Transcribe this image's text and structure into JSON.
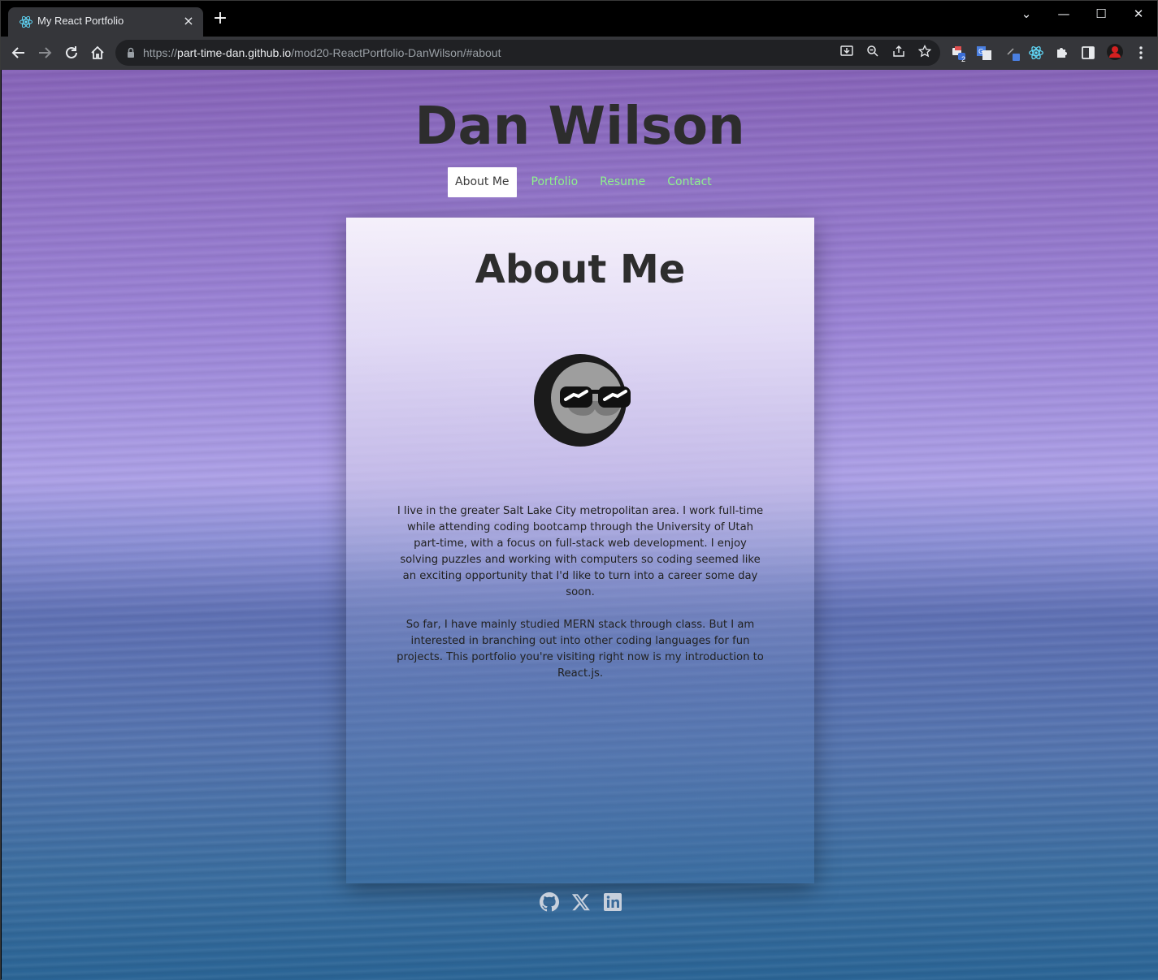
{
  "browser": {
    "tab_title": "My React Portfolio",
    "tab_close": "×",
    "new_tab": "+",
    "url_prefix": "https://",
    "url_host": "part-time-dan.github.io",
    "url_path": "/mod20-ReactPortfolio-DanWilson/#about",
    "window_controls": {
      "minimize": "—",
      "maximize": "☐",
      "close": "✕",
      "tab_search": "⌄"
    },
    "extension_badge": "2"
  },
  "site": {
    "title": "Dan Wilson",
    "nav": [
      {
        "label": "About Me",
        "active": true
      },
      {
        "label": "Portfolio",
        "active": false
      },
      {
        "label": "Resume",
        "active": false
      },
      {
        "label": "Contact",
        "active": false
      }
    ],
    "about": {
      "heading": "About Me",
      "paragraphs": [
        "I live in the greater Salt Lake City metropolitan area. I work full-time while attending coding bootcamp through the University of Utah part-time, with a focus on full-stack web development. I enjoy solving puzzles and working with computers so coding seemed like an exciting opportunity that I'd like to turn into a career some day soon.",
        "So far, I have mainly studied MERN stack through class. But I am interested in branching out into other coding languages for fun projects. This portfolio you're visiting right now is my introduction to React.js."
      ]
    },
    "social_icons": [
      "github-icon",
      "x-icon",
      "linkedin-icon"
    ]
  },
  "colors": {
    "nav_link": "#8ef08e",
    "heading": "#2d2d2d",
    "social_icon": "#c8d0dc"
  }
}
